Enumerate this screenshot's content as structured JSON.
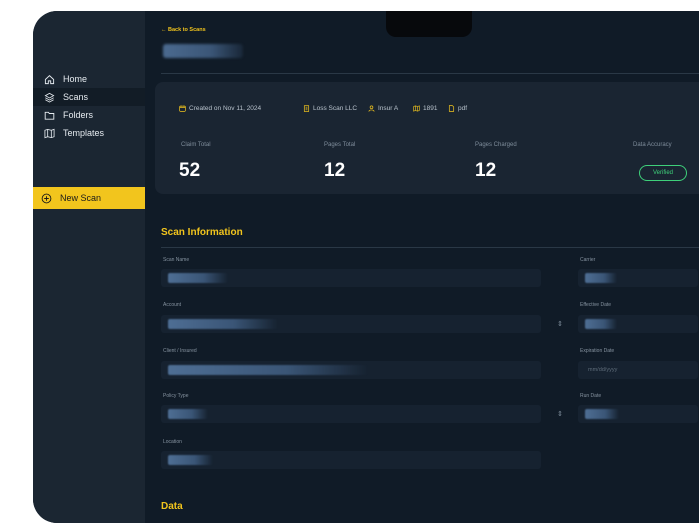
{
  "sidebar": {
    "items": [
      {
        "label": "Home",
        "icon": "home-icon"
      },
      {
        "label": "Scans",
        "icon": "layers-icon"
      },
      {
        "label": "Folders",
        "icon": "folder-icon"
      },
      {
        "label": "Templates",
        "icon": "map-icon"
      }
    ],
    "new_scan_label": "New Scan"
  },
  "header": {
    "back_label": "← Back to Scans"
  },
  "summary": {
    "created": "Created on Nov 11, 2024",
    "company": "Loss Scan LLC",
    "insurer": "Insur A",
    "number": "1891",
    "format": "pdf",
    "stats": [
      {
        "label": "Claim Total",
        "value": "52"
      },
      {
        "label": "Pages Total",
        "value": "12"
      },
      {
        "label": "Pages Charged",
        "value": "12"
      },
      {
        "label": "Data Accuracy",
        "value": ""
      }
    ],
    "verified_label": "Verified"
  },
  "scan_info": {
    "title": "Scan Information",
    "fields": {
      "scan_name": "Scan Name",
      "account": "Account",
      "client": "Client / Insured",
      "policy_type": "Policy Type",
      "location": "Location",
      "carrier": "Carrier",
      "effective_date": "Effective Date",
      "expiration_date": "Expiration Date",
      "expiration_placeholder": "mm/dd/yyyy",
      "run_date": "Run Date"
    }
  },
  "data_section": {
    "title": "Data"
  },
  "colors": {
    "accent": "#f2c51d",
    "background": "#101b27",
    "sidebar": "#1b2632",
    "success": "#3ed07a"
  }
}
